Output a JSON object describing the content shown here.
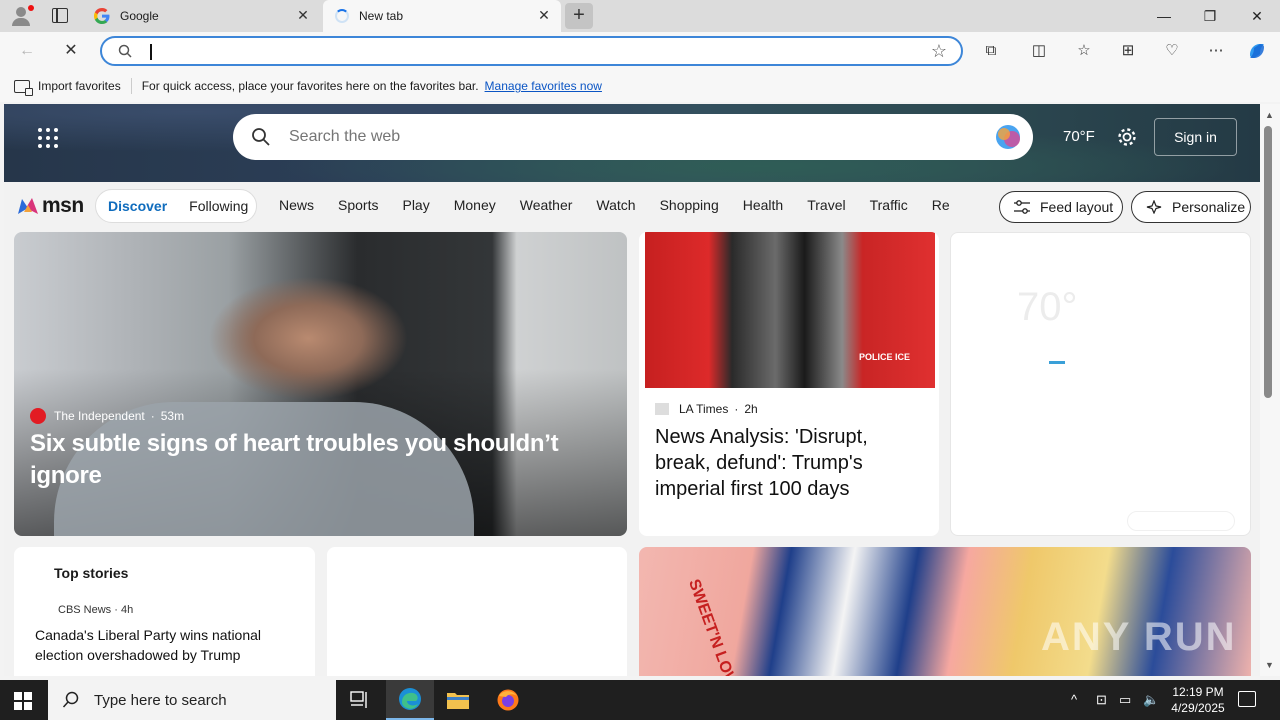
{
  "browser": {
    "tabs": [
      {
        "label": "Google"
      },
      {
        "label": "New tab"
      }
    ],
    "address": {
      "value": "",
      "placeholder": ""
    },
    "favorites_bar": {
      "import_label": "Import favorites",
      "hint": "For quick access, place your favorites here on the favorites bar.",
      "manage_link": "Manage favorites now"
    }
  },
  "msn": {
    "search_placeholder": "Search the web",
    "temperature": "70°F",
    "sign_in": "Sign in",
    "logo_text": "msn",
    "segment": {
      "discover": "Discover",
      "following": "Following"
    },
    "nav": [
      "News",
      "Sports",
      "Play",
      "Money",
      "Weather",
      "Watch",
      "Shopping",
      "Health",
      "Travel",
      "Traffic",
      "Real E"
    ],
    "feed_layout": "Feed layout",
    "personalize": "Personalize"
  },
  "cards": {
    "lead": {
      "source": "The Independent",
      "age": "53m",
      "title": "Six subtle signs of heart troubles you shouldn’t ignore"
    },
    "la": {
      "source": "LA Times",
      "age": "2h",
      "title": "News Analysis: 'Disrupt, break, defund': Trump's imperial first 100 days",
      "image_text": "POLICE ICE"
    },
    "weather": {
      "temp": "70°"
    },
    "top_stories": {
      "title": "Top stories",
      "source": "CBS News · 4h",
      "headline": "Canada's Liberal Party wins national election overshadowed by Trump"
    },
    "sweetener": {
      "label": "SWEET'N LOW"
    },
    "watermark": "ANY RUN"
  },
  "taskbar": {
    "search_placeholder": "Type here to search",
    "time": "12:19 PM",
    "date": "4/29/2025"
  },
  "colors": {
    "accent": "#0f6cbd",
    "address_border": "#3d86d8",
    "taskbar": "#1f1f1f"
  }
}
